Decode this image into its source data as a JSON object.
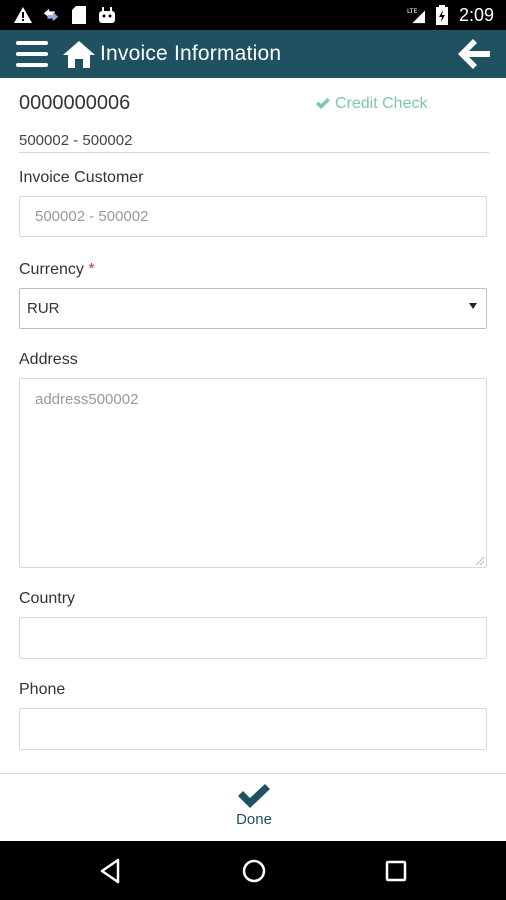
{
  "status_bar": {
    "time": "2:09",
    "network": "LTE",
    "icons": [
      "warning-icon",
      "transfer-icon",
      "sd-card-icon",
      "android-icon",
      "signal-icon",
      "battery-icon"
    ]
  },
  "app_bar": {
    "title": "Invoice Information",
    "icons": [
      "menu-icon",
      "home-icon",
      "back-arrow-icon"
    ]
  },
  "header": {
    "invoice_number": "0000000006",
    "credit_check": "Credit Check",
    "customer_sub": "500002 - 500002"
  },
  "form": {
    "invoice_customer": {
      "label": "Invoice Customer",
      "value": "500002 - 500002"
    },
    "currency": {
      "label": "Currency",
      "required_mark": "*",
      "value": "RUR"
    },
    "address": {
      "label": "Address",
      "value": "address500002"
    },
    "country": {
      "label": "Country",
      "value": ""
    },
    "phone": {
      "label": "Phone",
      "value": ""
    }
  },
  "bottom_bar": {
    "done_label": "Done"
  },
  "colors": {
    "app_bar": "#1f5161",
    "credit_check": "#7dc9a4",
    "required": "#e03030"
  }
}
